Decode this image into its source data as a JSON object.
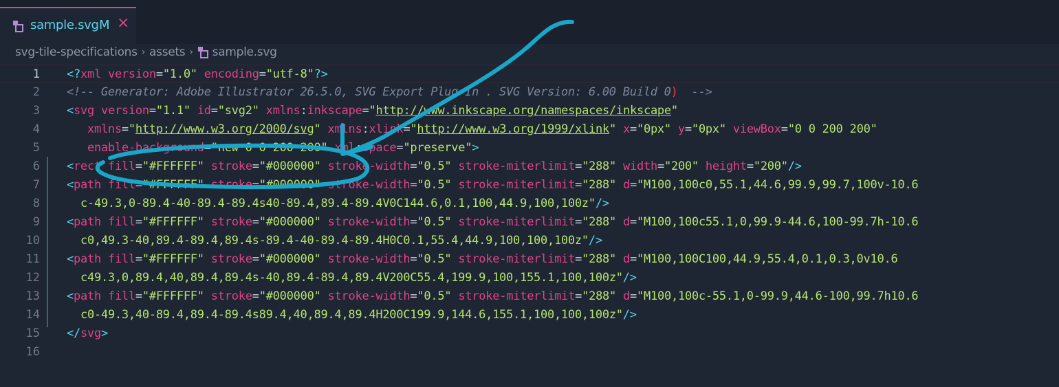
{
  "tab": {
    "filename": "sample.svg",
    "status": "M",
    "close_glyph": "×"
  },
  "breadcrumb": {
    "items": [
      "svg-tile-specifications",
      "assets",
      "sample.svg"
    ],
    "separator": "›"
  },
  "editor": {
    "line_numbers": [
      "1",
      "2",
      "3",
      "4",
      "5",
      "6",
      "7",
      "8",
      "9",
      "10",
      "11",
      "12",
      "13",
      "14",
      "15",
      "16"
    ],
    "active_line": 1
  },
  "code": {
    "l1": [
      "<?",
      "xml",
      " ",
      "version",
      "=",
      "\"1.0\"",
      " ",
      "encoding",
      "=",
      "\"utf-8\"",
      "?>"
    ],
    "l2": [
      "<!-- Generator: Adobe Illustrator 26.5.0, SVG Export Plug-In . SVG Version: 6.00 Build 0",
      ")",
      "  -->"
    ],
    "l3": [
      "<",
      "svg",
      " ",
      "version",
      "=",
      "\"1.1\"",
      " ",
      "id",
      "=",
      "\"svg2\"",
      " ",
      "xmlns",
      ":",
      "inkscape",
      "=",
      "\"",
      "http://www.inkscape.org/namespaces/inkscape",
      "\""
    ],
    "l4": [
      "   ",
      "xmlns",
      "=",
      "\"",
      "http://www.w3.org/2000/svg",
      "\"",
      " ",
      "xmlns",
      ":",
      "xlink",
      "=",
      "\"",
      "http://www.w3.org/1999/xlink",
      "\"",
      " ",
      "x",
      "=",
      "\"0px\"",
      " ",
      "y",
      "=",
      "\"0px\"",
      " ",
      "viewBox",
      "=",
      "\"0 0 200 200\""
    ],
    "l5": [
      "   ",
      "enable-background",
      "=",
      "\"new 0 0 200 200\"",
      " ",
      "xml",
      ":",
      "space",
      "=",
      "\"preserve\"",
      ">"
    ],
    "l6": [
      "<",
      "rect",
      " ",
      "fill",
      "=",
      "\"#FFFFFF\"",
      " ",
      "stroke",
      "=",
      "\"#000000\"",
      " ",
      "stroke-width",
      "=",
      "\"0.5\"",
      " ",
      "stroke-miterlimit",
      "=",
      "\"288\"",
      " ",
      "width",
      "=",
      "\"200\"",
      " ",
      "height",
      "=",
      "\"200\"",
      "/>"
    ],
    "l7": [
      "<",
      "path",
      " ",
      "fill",
      "=",
      "\"#FFFFFF\"",
      " ",
      "stroke",
      "=",
      "\"#000000\"",
      " ",
      "stroke-width",
      "=",
      "\"0.5\"",
      " ",
      "stroke-miterlimit",
      "=",
      "\"288\"",
      " ",
      "d",
      "=",
      "\"M100,100c0,55.1,44.6,99.9,99.7,100v-10.6"
    ],
    "l8": [
      "  ",
      "c-49.3,0-89.4-40-89.4-89.4s40-89.4,89.4-89.4V0C144.6,0.1,100,44.9,100,100z\"",
      "/>"
    ],
    "l9": [
      "<",
      "path",
      " ",
      "fill",
      "=",
      "\"#FFFFFF\"",
      " ",
      "stroke",
      "=",
      "\"#000000\"",
      " ",
      "stroke-width",
      "=",
      "\"0.5\"",
      " ",
      "stroke-miterlimit",
      "=",
      "\"288\"",
      " ",
      "d",
      "=",
      "\"M100,100c55.1,0,99.9-44.6,100-99.7h-10.6"
    ],
    "l10": [
      "  ",
      "c0,49.3-40,89.4-89.4,89.4s-89.4-40-89.4-89.4H0C0.1,55.4,44.9,100,100,100z\"",
      "/>"
    ],
    "l11": [
      "<",
      "path",
      " ",
      "fill",
      "=",
      "\"#FFFFFF\"",
      " ",
      "stroke",
      "=",
      "\"#000000\"",
      " ",
      "stroke-width",
      "=",
      "\"0.5\"",
      " ",
      "stroke-miterlimit",
      "=",
      "\"288\"",
      " ",
      "d",
      "=",
      "\"M100,100C100,44.9,55.4,0.1,0.3,0v10.6"
    ],
    "l12": [
      "  ",
      "c49.3,0,89.4,40,89.4,89.4s-40,89.4-89.4,89.4V200C55.4,199.9,100,155.1,100,100z\"",
      "/>"
    ],
    "l13": [
      "<",
      "path",
      " ",
      "fill",
      "=",
      "\"#FFFFFF\"",
      " ",
      "stroke",
      "=",
      "\"#000000\"",
      " ",
      "stroke-width",
      "=",
      "\"0.5\"",
      " ",
      "stroke-miterlimit",
      "=",
      "\"288\"",
      " ",
      "d",
      "=",
      "\"M100,100c-55.1,0-99.9,44.6-100,99.7h10.6"
    ],
    "l14": [
      "  ",
      "c0-49.3,40-89.4,89.4-89.4s89.4,40,89.4,89.4H200C199.9,144.6,155.1,100,100,100z\"",
      "/>"
    ],
    "l15": [
      "</",
      "svg",
      ">"
    ],
    "l16": []
  },
  "colors": {
    "background": "#1e2533",
    "tab_accent": "#e0438a",
    "annotation": "#1aa6c8"
  },
  "annotation": {
    "description_icon": "hand-drawn-arrow-and-circle"
  }
}
